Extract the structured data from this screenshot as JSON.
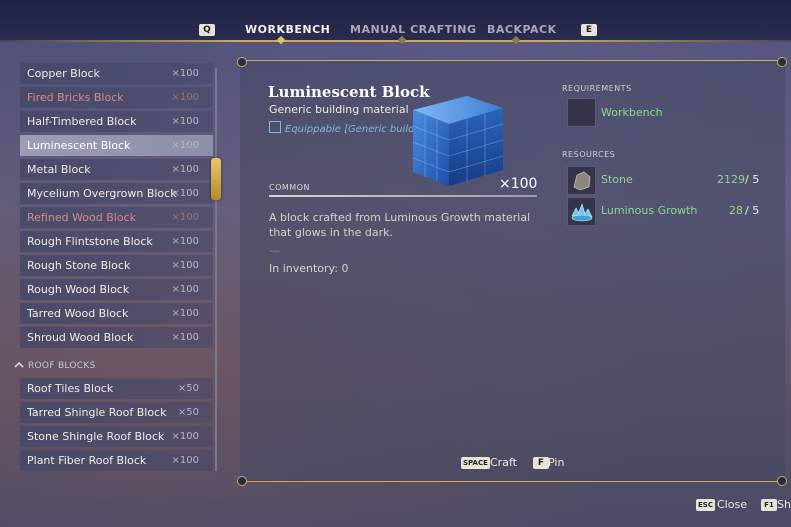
{
  "nav": {
    "key_left": "Q",
    "key_right": "E",
    "tabs": [
      "WORKBENCH",
      "MANUAL CRAFTING",
      "BACKPACK"
    ]
  },
  "list": {
    "items": [
      {
        "name": "Copper Block",
        "qty": "×100"
      },
      {
        "name": "Fired Bricks Block",
        "qty": "×100"
      },
      {
        "name": "Half-Timbered Block",
        "qty": "×100"
      },
      {
        "name": "Luminescent Block",
        "qty": "×100"
      },
      {
        "name": "Metal Block",
        "qty": "×100"
      },
      {
        "name": "Mycelium Overgrown Block",
        "qty": "×100"
      },
      {
        "name": "Refined Wood Block",
        "qty": "×100"
      },
      {
        "name": "Rough Flintstone Block",
        "qty": "×100"
      },
      {
        "name": "Rough Stone Block",
        "qty": "×100"
      },
      {
        "name": "Rough Wood Block",
        "qty": "×100"
      },
      {
        "name": "Tarred Wood Block",
        "qty": "×100"
      },
      {
        "name": "Shroud Wood Block",
        "qty": "×100"
      }
    ],
    "section": "ROOF BLOCKS",
    "roof_items": [
      {
        "name": "Roof Tiles Block",
        "qty": "×50"
      },
      {
        "name": "Tarred Shingle Roof Block",
        "qty": "×50"
      },
      {
        "name": "Stone Shingle Roof Block",
        "qty": "×100"
      },
      {
        "name": "Plant Fiber Roof Block",
        "qty": "×100"
      }
    ]
  },
  "detail": {
    "title": "Luminescent Block",
    "subtitle": "Generic building material",
    "equippable": "Equippable [Generic building material]",
    "rarity": "COMMON",
    "quantity": "×100",
    "description": "A block crafted from Luminous Growth material that glows in the dark.",
    "separator": "—",
    "inventory": "In inventory: 0"
  },
  "requirements": {
    "heading": "REQUIREMENTS",
    "station": "Workbench"
  },
  "resources": {
    "heading": "RESOURCES",
    "items": [
      {
        "name": "Stone",
        "have": "2129",
        "need": "/ 5"
      },
      {
        "name": "Luminous Growth",
        "have": "28",
        "need": "/ 5"
      }
    ]
  },
  "hints": {
    "craft_key": "SPACE",
    "craft": "Craft",
    "pin_key": "F",
    "pin": "Pin",
    "close_key": "ESC",
    "close": "Close",
    "extra_key": "F1",
    "extra": "Sh"
  },
  "colors": {
    "accent_gold": "#c9a95a",
    "resource_green": "#8fd88a",
    "unavailable_red": "#d98787",
    "equip_blue": "#86b6d9"
  }
}
